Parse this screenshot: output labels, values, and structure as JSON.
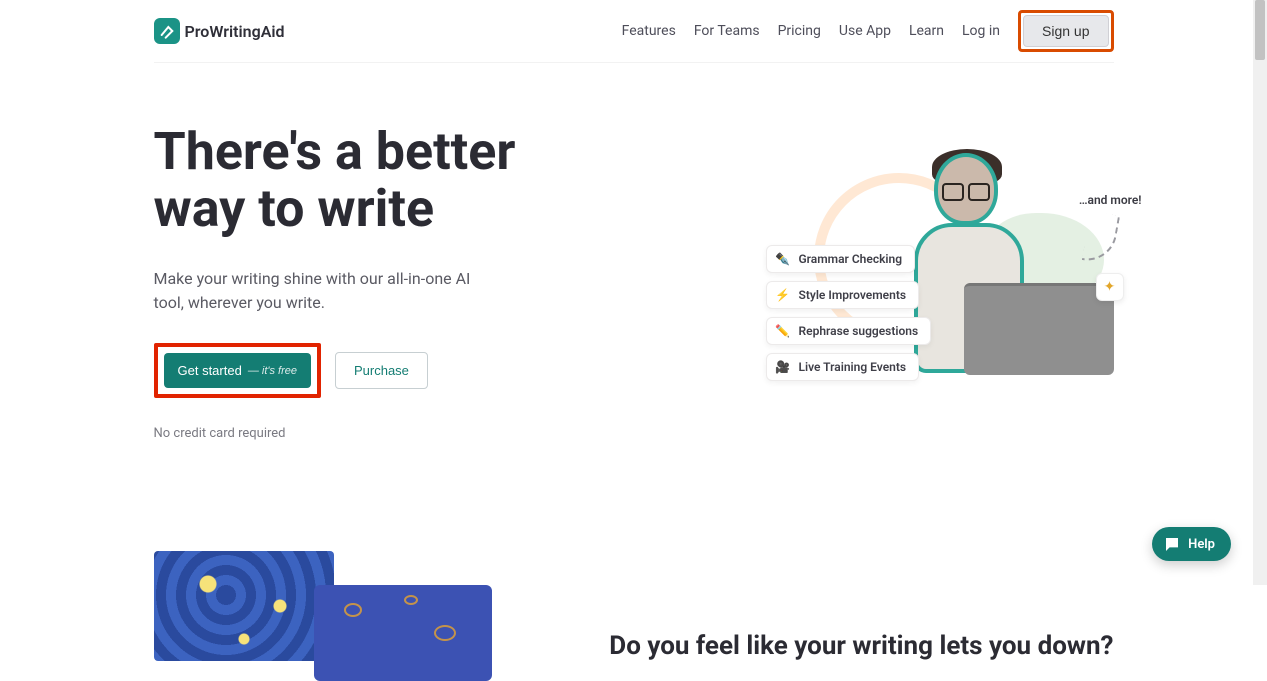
{
  "brand": {
    "name": "ProWritingAid"
  },
  "nav": {
    "features": "Features",
    "teams": "For Teams",
    "pricing": "Pricing",
    "use_app": "Use App",
    "learn": "Learn",
    "login": "Log in",
    "signup": "Sign up"
  },
  "hero": {
    "title": "There's a better way to write",
    "subtitle": "Make your writing shine with our all-in-one AI tool, wherever you write.",
    "primary_label": "Get started",
    "primary_sub": "— it's free",
    "secondary_label": "Purchase",
    "credit_note": "No credit card required",
    "and_more": "…and more!",
    "spark_glyph": "✦",
    "chips": [
      {
        "icon": "✒️",
        "label": "Grammar Checking"
      },
      {
        "icon": "⚡",
        "label": "Style Improvements"
      },
      {
        "icon": "✏️",
        "label": "Rephrase suggestions"
      },
      {
        "icon": "🎥",
        "label": "Live Training Events"
      }
    ]
  },
  "section2": {
    "title": "Do you feel like your writing lets you down?"
  },
  "help": {
    "label": "Help"
  },
  "colors": {
    "brand": "#147d73",
    "highlight_orange": "#d94b00",
    "highlight_red": "#e12300"
  }
}
